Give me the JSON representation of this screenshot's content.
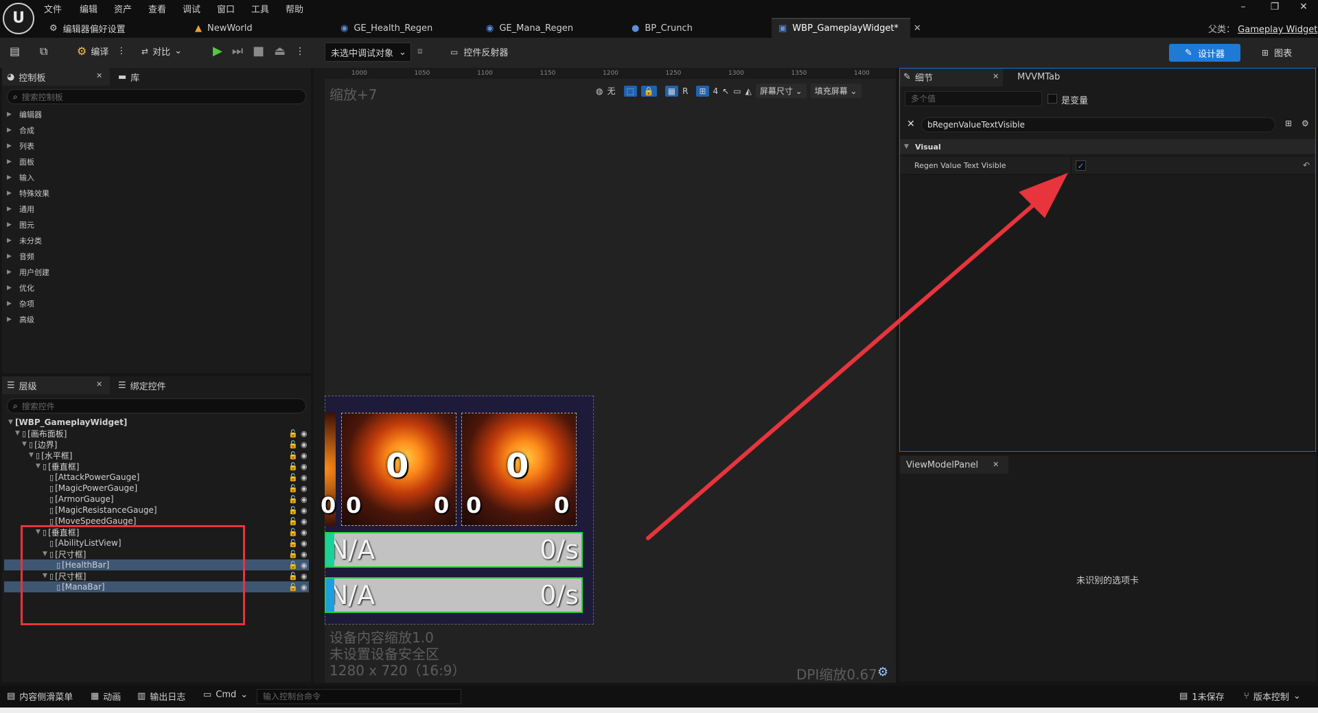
{
  "menu": [
    "文件",
    "编辑",
    "资产",
    "查看",
    "调试",
    "窗口",
    "工具",
    "帮助"
  ],
  "tabs": {
    "editor_prefs": "编辑器偏好设置",
    "newworld": "NewWorld",
    "health": "GE_Health_Regen",
    "mana": "GE_Mana_Regen",
    "crunch": "BP_Crunch",
    "active": "WBP_GameplayWidget*"
  },
  "parent": {
    "label": "父类：",
    "value": "Gameplay Widget"
  },
  "toolbar": {
    "compile": "编译",
    "diff": "对比",
    "debug_target": "未选中调试对象",
    "reflector": "控件反射器",
    "designer": "设计器",
    "graph": "图表"
  },
  "palette": {
    "tab": "控制板",
    "library_tab": "库",
    "search_placeholder": "搜索控制板",
    "categories": [
      "编辑器",
      "合成",
      "列表",
      "面板",
      "输入",
      "特殊效果",
      "通用",
      "图元",
      "未分类",
      "音频",
      "用户创建",
      "优化",
      "杂项",
      "高级"
    ]
  },
  "hierarchy": {
    "tab": "层级",
    "bind_tab": "绑定控件",
    "search_placeholder": "搜索控件",
    "items": [
      {
        "label": "[WBP_GameplayWidget]",
        "indent": 0
      },
      {
        "label": "[画布面板]",
        "indent": 1
      },
      {
        "label": "[边界]",
        "indent": 2
      },
      {
        "label": "[水平框]",
        "indent": 3
      },
      {
        "label": "[垂直框]",
        "indent": 4
      },
      {
        "label": "[AttackPowerGauge]",
        "indent": 5
      },
      {
        "label": "[MagicPowerGauge]",
        "indent": 5
      },
      {
        "label": "[ArmorGauge]",
        "indent": 5
      },
      {
        "label": "[MagicResistanceGauge]",
        "indent": 5
      },
      {
        "label": "[MoveSpeedGauge]",
        "indent": 5
      },
      {
        "label": "[垂直框]",
        "indent": 4
      },
      {
        "label": "[AbilityListView]",
        "indent": 5
      },
      {
        "label": "[尺寸框]",
        "indent": 5
      },
      {
        "label": "[HealthBar]",
        "indent": 6
      },
      {
        "label": "[尺寸框]",
        "indent": 5
      },
      {
        "label": "[ManaBar]",
        "indent": 6
      }
    ]
  },
  "viewport": {
    "zoom": "缩放+7",
    "ruler_ticks": [
      "1000",
      "1050",
      "1100",
      "1150",
      "1200",
      "1250",
      "1300",
      "1350",
      "1400"
    ],
    "toolbar": {
      "none": "无",
      "r": "R",
      "grid_size": "4",
      "screen_size": "屏幕尺寸",
      "fill_screen": "填充屏幕"
    },
    "cards": [
      {
        "big": "0",
        "left": "0",
        "right": "0"
      },
      {
        "big": "0",
        "left": "0",
        "right": "0"
      }
    ],
    "left_partial_num": "0",
    "health_bar": {
      "left": "N/A",
      "right": "0/s",
      "accent": "#19d39a"
    },
    "mana_bar": {
      "left": "N/A",
      "right": "0/s",
      "accent": "#1a9fe0"
    },
    "info_lines": [
      "设备内容缩放1.0",
      "未设置设备安全区",
      "1280 x 720（16:9）"
    ],
    "dpi": "DPI缩放0.67"
  },
  "details": {
    "tab": "细节",
    "mvvm_tab": "MVVMTab",
    "name_placeholder": "多个值",
    "is_variable": "是变量",
    "search_value": "bRegenValueTextVisible",
    "section": "Visual",
    "property_label": "Regen Value Text Visible",
    "property_checked": true
  },
  "viewmodel_panel": {
    "tab": "ViewModelPanel",
    "message": "未识别的选项卡"
  },
  "statusbar": {
    "content_drawer": "内容侧滑菜单",
    "animation": "动画",
    "output_log": "输出日志",
    "cmd": "Cmd",
    "console_placeholder": "输入控制台命令",
    "unsaved": "1未保存",
    "source_control": "版本控制"
  },
  "colors": {
    "accent": "#1f7ad6",
    "highlight": "#e8343c",
    "selected_row": "#3e5672"
  }
}
